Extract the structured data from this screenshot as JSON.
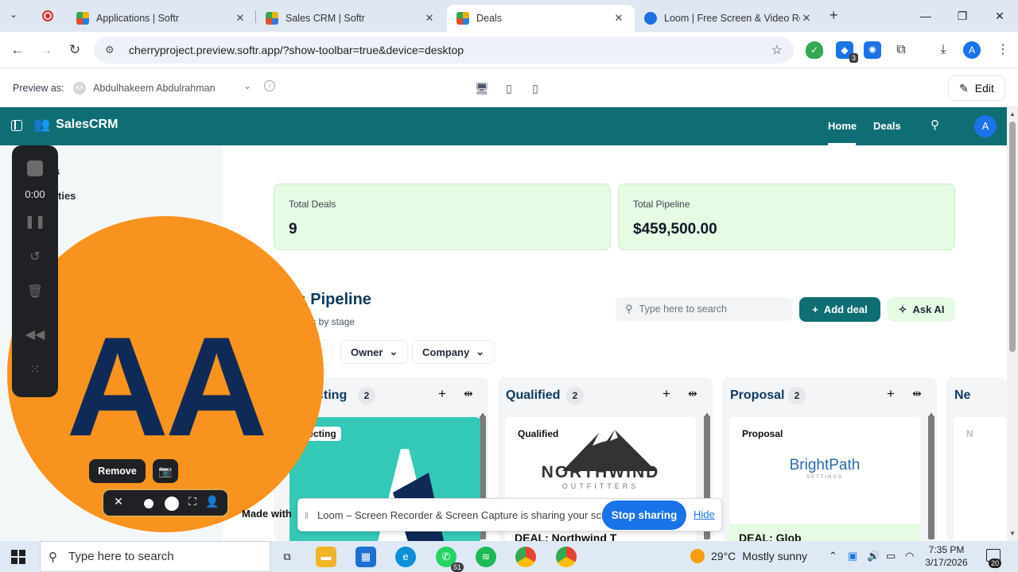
{
  "browser": {
    "tabs": [
      {
        "title": "Applications | Softr",
        "icon": "softr-icon"
      },
      {
        "title": "Sales CRM | Softr",
        "icon": "softr-icon"
      },
      {
        "title": "Deals",
        "icon": "softr-icon",
        "active": true
      },
      {
        "title": "Loom | Free Screen & Video Re",
        "icon": "loom-icon"
      }
    ],
    "url": "cherryproject.preview.softr.app/?show-toolbar=true&device=desktop",
    "extension_badge": "3",
    "profile_initial": "A"
  },
  "preview_bar": {
    "label": "Preview as:",
    "user": "Abdulhakeem Abdulrahman",
    "user_initials": "AA",
    "edit_label": "Edit"
  },
  "app": {
    "brand": "SalesCRM",
    "nav": [
      "Home",
      "Deals"
    ],
    "avatar_initial": "A",
    "accent_color": "#0f6e73"
  },
  "sidebar": {
    "items": [
      "s",
      "ties"
    ]
  },
  "stats": [
    {
      "label": "Total Deals",
      "value": "9"
    },
    {
      "label": "Total Pipeline",
      "value": "$459,500.00"
    }
  ],
  "pipeline": {
    "title": "ls Pipeline",
    "subtitle": "als by stage",
    "search_placeholder": "Type here to search",
    "add_label": "Add deal",
    "ai_label": "Ask AI",
    "filters": [
      "Owner",
      "Company"
    ]
  },
  "columns": [
    {
      "title": "cting",
      "count": "2",
      "card_tag": "pecting"
    },
    {
      "title": "Qualified",
      "count": "2",
      "card_tag": "Qualified",
      "logo": "NORTHWIND",
      "logo_sub": "OUTFITTERS",
      "footer": "DEAL: Northwind T"
    },
    {
      "title": "Proposal",
      "count": "2",
      "card_tag": "Proposal",
      "logo": "BrightPath",
      "logo_sub": "SETTINGS",
      "footer": "DEAL: Glob"
    },
    {
      "title": "Ne",
      "count": "",
      "card_tag": "N"
    }
  ],
  "loom": {
    "timer": "0:00",
    "initials": "AA",
    "remove_label": "Remove",
    "made_with": "Made with",
    "share_text": "Loom – Screen Recorder & Screen Capture is sharing your screen.",
    "stop_label": "Stop sharing",
    "hide_label": "Hide"
  },
  "taskbar": {
    "search_placeholder": "Type here to search",
    "whatsapp_badge": "51",
    "temperature": "29°C",
    "weather": "Mostly sunny",
    "time": "7:35 PM",
    "date": "3/17/2026",
    "notifications": "20"
  }
}
